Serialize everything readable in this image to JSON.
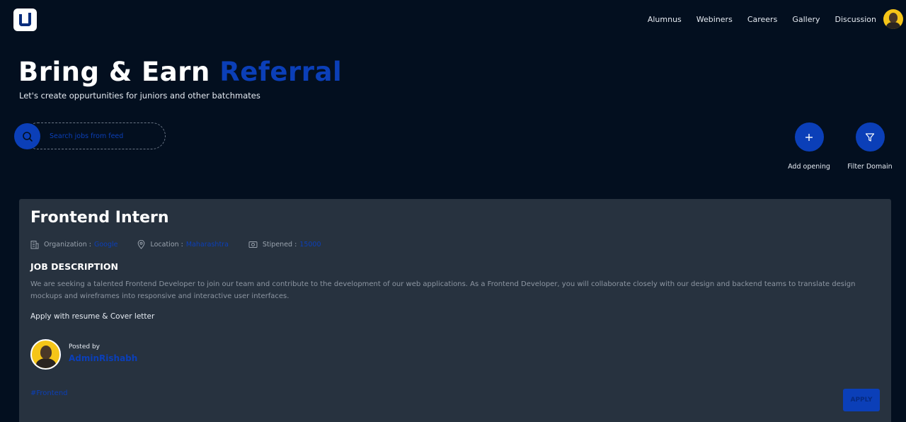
{
  "nav": {
    "items": [
      "Alumnus",
      "Webiners",
      "Careers",
      "Gallery",
      "Discussion"
    ]
  },
  "hero": {
    "title": "Bring & Earn",
    "title_accent": "Referral",
    "subtitle": "Let's create oppurtunities for juniors and other batchmates"
  },
  "search": {
    "placeholder": "Search jobs from feed"
  },
  "actions": {
    "add_label": "Add opening",
    "filter_label": "Filter Domain"
  },
  "job": {
    "title": "Frontend Intern",
    "organization_label": "Organization :",
    "organization_value": "Google",
    "location_label": "Location :",
    "location_value": "Maharashtra",
    "stipend_label": "Stipened :",
    "stipend_value": "15000",
    "description_heading": "JOB DESCRIPTION",
    "description": "We are seeking a talented Frontend Developer to join our team and contribute to the development of our web applications. As a Frontend Developer, you will collaborate closely with our design and backend teams to translate design mockups and wireframes into responsive and interactive user interfaces.",
    "apply_note": "Apply with resume & Cover letter",
    "posted_by_label": "Posted by",
    "posted_by_name": "AdminRishabh",
    "tag": "#Frontend",
    "apply_label": "APPLY"
  },
  "colors": {
    "background": "#030f1f",
    "card": "#27323f",
    "accent": "#0b3fb8"
  }
}
